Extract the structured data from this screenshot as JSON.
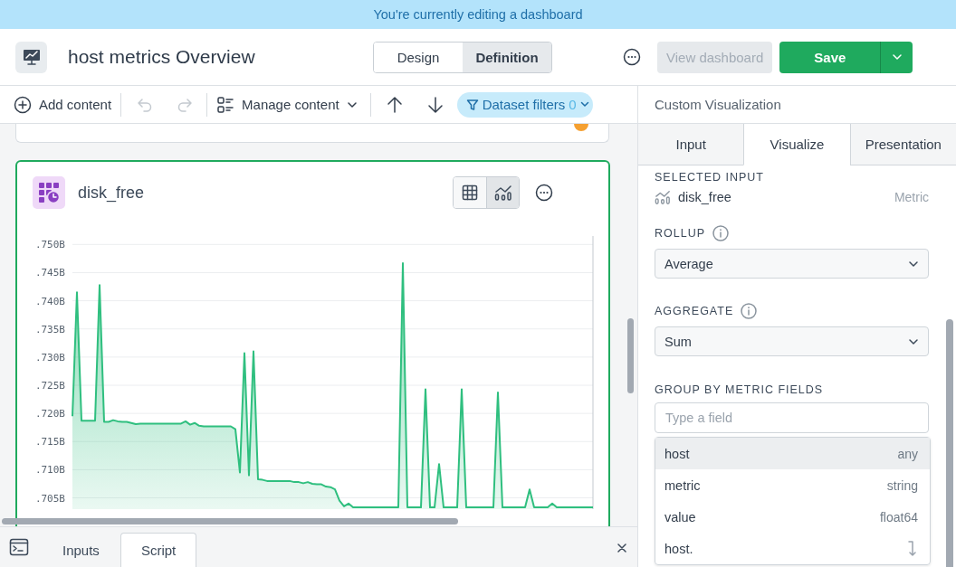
{
  "banner": {
    "text": "You're currently editing a dashboard"
  },
  "header": {
    "title": "host metrics Overview",
    "mode_tabs": [
      {
        "label": "Design",
        "selected": false
      },
      {
        "label": "Definition",
        "selected": true
      }
    ],
    "view_button": {
      "label": "View dashboard",
      "disabled": true
    },
    "save_button": {
      "label": "Save"
    }
  },
  "toolbar": {
    "add_content": "Add content",
    "undo": {
      "disabled": true
    },
    "redo": {
      "disabled": true
    },
    "manage_content": "Manage content",
    "dataset_filters": {
      "label": "Dataset filters",
      "count": "0"
    }
  },
  "card": {
    "title": "disk_free",
    "view_toggle": [
      {
        "kind": "table",
        "selected": false
      },
      {
        "kind": "chart",
        "selected": true
      }
    ],
    "chart_data": {
      "type": "area",
      "ylim": [
        0.703,
        0.7515
      ],
      "grid": true,
      "yticks": [
        {
          "value": 0.75,
          "label": ".750B"
        },
        {
          "value": 0.745,
          "label": ".745B"
        },
        {
          "value": 0.74,
          "label": ".740B"
        },
        {
          "value": 0.735,
          "label": ".735B"
        },
        {
          "value": 0.73,
          "label": ".730B"
        },
        {
          "value": 0.725,
          "label": ".725B"
        },
        {
          "value": 0.72,
          "label": ".720B"
        },
        {
          "value": 0.715,
          "label": ".715B"
        },
        {
          "value": 0.71,
          "label": ".710B"
        },
        {
          "value": 0.705,
          "label": ".705B"
        }
      ],
      "series": [
        {
          "color": "#2fbf7f",
          "values": [
            0.7195,
            0.7415,
            0.7187,
            0.7187,
            0.7187,
            0.7187,
            0.7428,
            0.7185,
            0.7185,
            0.7188,
            0.7186,
            0.7185,
            0.7185,
            0.7183,
            0.7181,
            0.7182,
            0.7182,
            0.7182,
            0.7182,
            0.7182,
            0.7182,
            0.7182,
            0.7182,
            0.7182,
            0.7182,
            0.7186,
            0.718,
            0.7183,
            0.7178,
            0.7177,
            0.7177,
            0.7177,
            0.7177,
            0.7177,
            0.7177,
            0.7177,
            0.7172,
            0.7095,
            0.7307,
            0.709,
            0.731,
            0.7083,
            0.7082,
            0.708,
            0.708,
            0.708,
            0.708,
            0.708,
            0.708,
            0.7078,
            0.7078,
            0.7076,
            0.7078,
            0.7075,
            0.7074,
            0.7074,
            0.707,
            0.7069,
            0.7065,
            0.7045,
            0.7035,
            0.704,
            0.7033,
            0.7033,
            0.7033,
            0.7033,
            0.7033,
            0.7033,
            0.7033,
            0.7033,
            0.7033,
            0.7033,
            0.7033,
            0.7467,
            0.7033,
            0.7033,
            0.7033,
            0.7033,
            0.7243,
            0.7033,
            0.7033,
            0.711,
            0.7033,
            0.7033,
            0.7033,
            0.7033,
            0.7243,
            0.7033,
            0.7033,
            0.7033,
            0.7033,
            0.7033,
            0.7033,
            0.7033,
            0.7237,
            0.7033,
            0.7033,
            0.7033,
            0.7033,
            0.7033,
            0.7033,
            0.7065,
            0.7033,
            0.7033,
            0.7033,
            0.7033,
            0.704,
            0.7033,
            0.7033,
            0.7033,
            0.7033,
            0.7033,
            0.7033,
            0.7033,
            0.7033,
            0.7033
          ]
        }
      ]
    }
  },
  "bottom_panel": {
    "tabs": [
      {
        "label": "Inputs",
        "selected": false
      },
      {
        "label": "Script",
        "selected": true
      }
    ]
  },
  "side_panel": {
    "title": "Custom Visualization",
    "tabs": [
      {
        "label": "Input",
        "selected": false
      },
      {
        "label": "Visualize",
        "selected": true
      },
      {
        "label": "Presentation",
        "selected": false
      }
    ],
    "selected_input": {
      "label": "SELECTED INPUT",
      "name": "disk_free",
      "type": "Metric"
    },
    "rollup": {
      "label": "ROLLUP",
      "value": "Average"
    },
    "aggregate": {
      "label": "AGGREGATE",
      "value": "Sum"
    },
    "group_by": {
      "label": "GROUP BY METRIC FIELDS",
      "placeholder": "Type a field",
      "options": [
        {
          "kind": "field",
          "name": "host",
          "type": "any",
          "selected": true
        },
        {
          "kind": "field",
          "name": "metric",
          "type": "string",
          "selected": false
        },
        {
          "kind": "field",
          "name": "value",
          "type": "float64",
          "selected": false
        },
        {
          "kind": "nested",
          "name": "host.",
          "selected": false
        }
      ]
    }
  }
}
